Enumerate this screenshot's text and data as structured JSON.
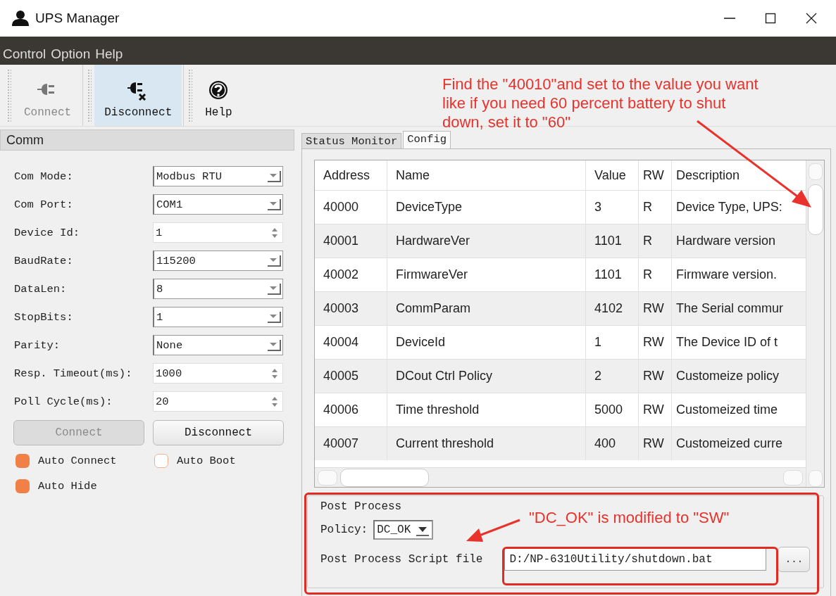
{
  "window": {
    "title": "UPS Manager"
  },
  "menu": [
    "Control",
    "Option",
    "Help"
  ],
  "toolbar": [
    {
      "label": "Connect",
      "kind": "plug",
      "disabled": true,
      "highlighted": false
    },
    {
      "label": "Disconnect",
      "kind": "unplug",
      "disabled": false,
      "highlighted": true
    },
    {
      "label": "Help",
      "kind": "help",
      "disabled": false,
      "highlighted": false
    }
  ],
  "comm": {
    "title": "Comm",
    "fields": [
      {
        "label": "Com Mode:",
        "kind": "combo",
        "value": "Modbus RTU"
      },
      {
        "label": "Com Port:",
        "kind": "combo",
        "value": "COM1"
      },
      {
        "label": "Device Id:",
        "kind": "spin",
        "value": "1"
      },
      {
        "label": "BaudRate:",
        "kind": "combo",
        "value": "115200"
      },
      {
        "label": "DataLen:",
        "kind": "combo",
        "value": "8"
      },
      {
        "label": "StopBits:",
        "kind": "combo",
        "value": "1"
      },
      {
        "label": "Parity:",
        "kind": "combo",
        "value": "None"
      },
      {
        "label": "Resp. Timeout(ms):",
        "kind": "spin",
        "value": "1000"
      },
      {
        "label": "Poll Cycle(ms):",
        "kind": "spin",
        "value": "20"
      }
    ],
    "buttons": [
      {
        "label": "Connect",
        "disabled": true
      },
      {
        "label": "Disconnect",
        "disabled": false
      }
    ],
    "options": [
      {
        "label": "Auto Connect",
        "checked": true
      },
      {
        "label": "Auto Boot",
        "checked": false
      },
      {
        "label": "Auto Hide",
        "checked": true
      }
    ]
  },
  "tabs": [
    {
      "label": "Status Monitor",
      "selected": false
    },
    {
      "label": "Config",
      "selected": true
    }
  ],
  "table": {
    "columns": [
      "Address",
      "Name",
      "Value",
      "RW",
      "Description"
    ],
    "rows": [
      [
        "40000",
        "DeviceType",
        "3",
        "R",
        "Device Type, UPS:"
      ],
      [
        "40001",
        "HardwareVer",
        "1101",
        "R",
        "Hardware version"
      ],
      [
        "40002",
        "FirmwareVer",
        "1101",
        "R",
        "Firmware version."
      ],
      [
        "40003",
        "CommParam",
        "4102",
        "RW",
        "The Serial commur"
      ],
      [
        "40004",
        "DeviceId",
        "1",
        "RW",
        "The Device ID of t"
      ],
      [
        "40005",
        "DCout Ctrl Policy",
        "2",
        "RW",
        "Customeize policy"
      ],
      [
        "40006",
        "Time threshold",
        "5000",
        "RW",
        "Customeized time"
      ],
      [
        "40007",
        "Current threshold",
        "400",
        "RW",
        "Customeized curre"
      ]
    ]
  },
  "post_process": {
    "title": "Post Process",
    "policy_label": "Policy:",
    "policy": "DC_OK",
    "script_label": "Post Process Script file",
    "script_path": "D:/NP-6310Utility/shutdown.bat",
    "browse_button": "..."
  },
  "annotations": [
    {
      "lines": [
        "Find the \"40010\"and set to the value you want",
        "like if you need 60 percent battery to shut",
        "down, set it to \"60\""
      ]
    },
    {
      "lines": [
        "\"DC_OK\" is modified to \"SW\""
      ]
    }
  ]
}
